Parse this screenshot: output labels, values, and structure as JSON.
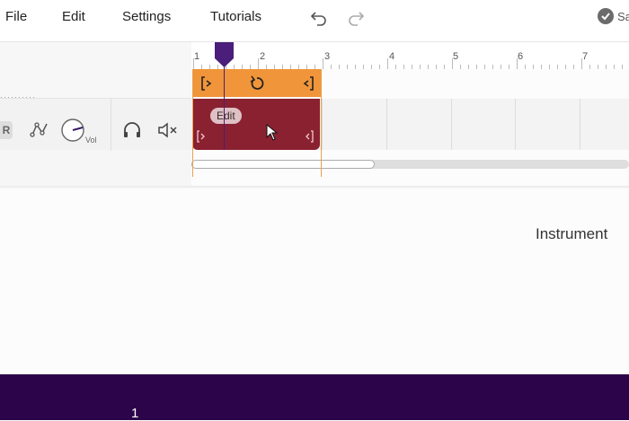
{
  "menu": {
    "file": "File",
    "edit": "Edit",
    "settings": "Settings",
    "tutorials": "Tutorials",
    "save_label": "Sa"
  },
  "track": {
    "truncated_name": "··········",
    "record_badge": "R",
    "volume_label": "Vol"
  },
  "ruler": {
    "marks": [
      "1",
      "2",
      "3",
      "4",
      "5",
      "6",
      "7"
    ]
  },
  "clip": {
    "edit_label": "Edit"
  },
  "content": {
    "instrument_label": "Instrument"
  },
  "keyboard": {
    "octave_label": "1"
  },
  "colors": {
    "loop": "#f0953a",
    "clip": "#8a2130",
    "playhead": "#4a1e7a",
    "keyboard_bar": "#2c044a"
  },
  "icons": [
    "undo-icon",
    "redo-icon",
    "saved-check-icon",
    "automation-icon",
    "volume-knob-icon",
    "headphones-icon",
    "mute-icon",
    "loop-icon",
    "loop-start-icon",
    "loop-end-icon",
    "cursor-icon"
  ]
}
